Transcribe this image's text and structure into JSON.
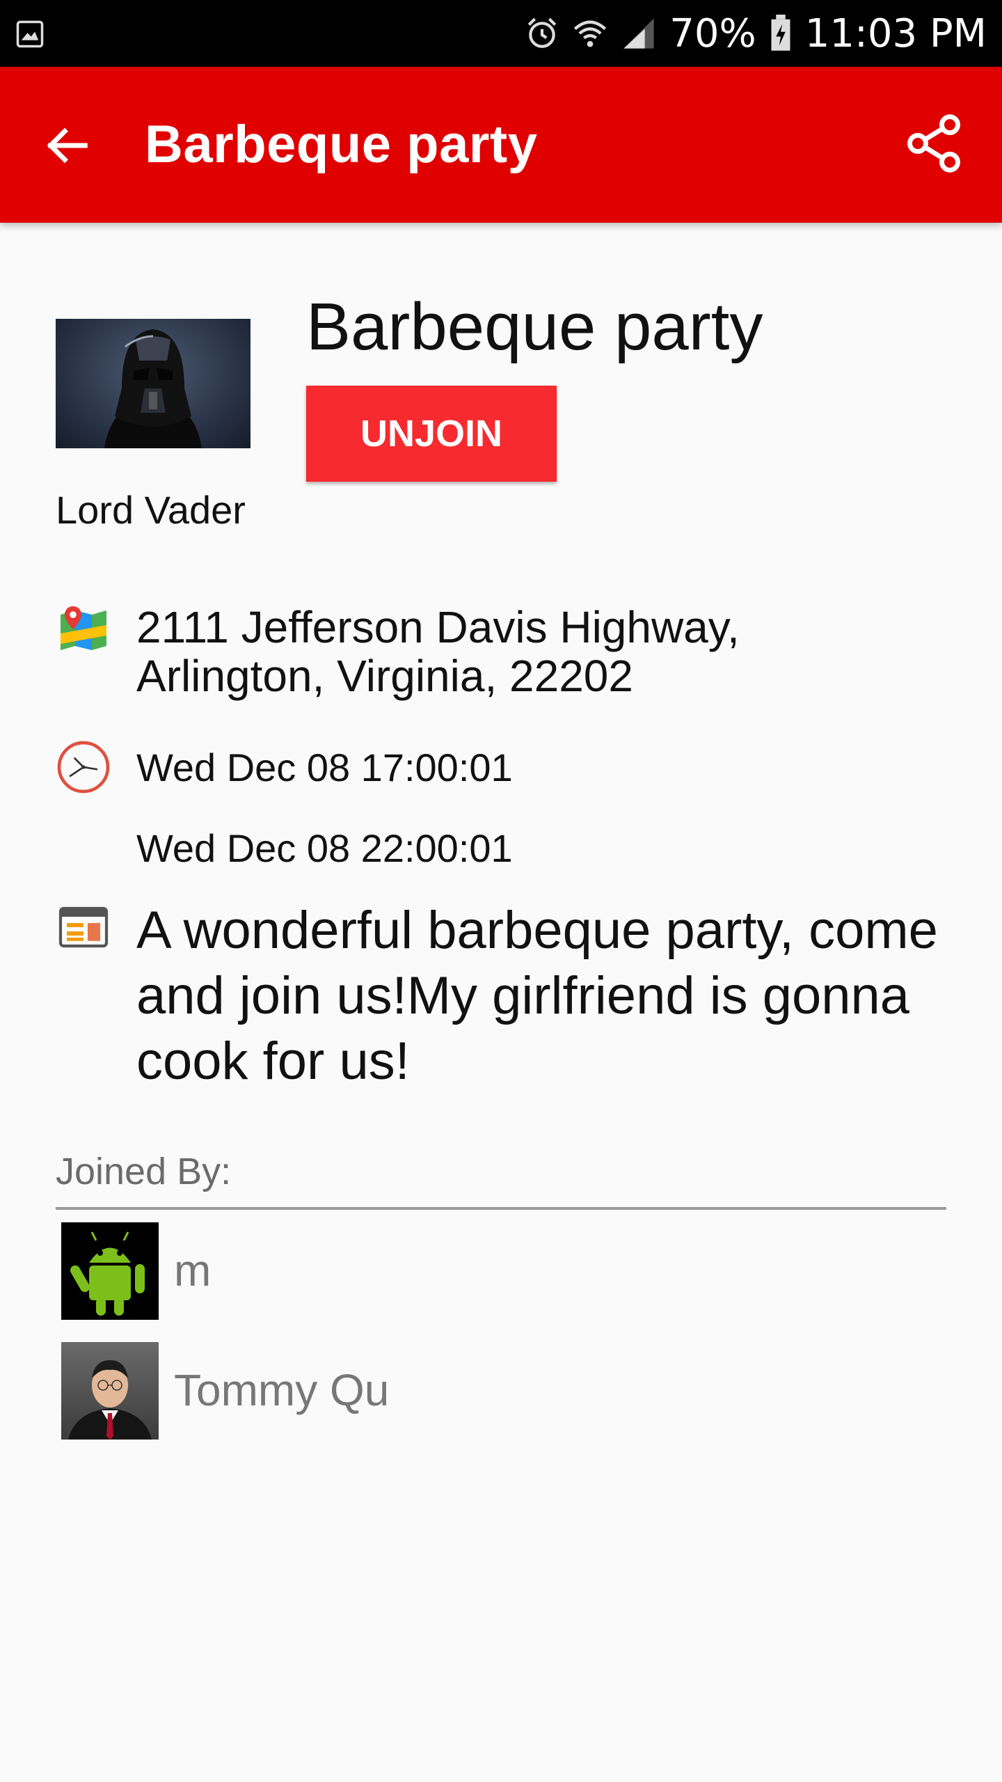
{
  "status_bar": {
    "battery": "70%",
    "time": "11:03 PM",
    "icons": [
      "gallery-icon",
      "alarm-icon",
      "wifi-icon",
      "signal-icon",
      "battery-charging-icon"
    ]
  },
  "app_bar": {
    "title": "Barbeque party",
    "color": "#e00000",
    "back_icon": "arrow-back-icon",
    "share_icon": "share-icon"
  },
  "event": {
    "host_name": "Lord Vader",
    "title": "Barbeque party",
    "unjoin_label": "UNJOIN",
    "address_line1": "2111 Jefferson Davis Highway,",
    "address_line2": "Arlington, Virginia, 22202",
    "start_time": "Wed Dec 08 17:00:01",
    "end_time": "Wed Dec 08 22:00:01",
    "description": "A wonderful barbeque party, come and join us!My girlfriend is gonna cook for us!",
    "button_color": "#f62a2f"
  },
  "joined": {
    "label": "Joined By:",
    "members": [
      {
        "name": "m",
        "avatar": "android-robot"
      },
      {
        "name": "Tommy Qu",
        "avatar": "person-photo"
      }
    ]
  }
}
